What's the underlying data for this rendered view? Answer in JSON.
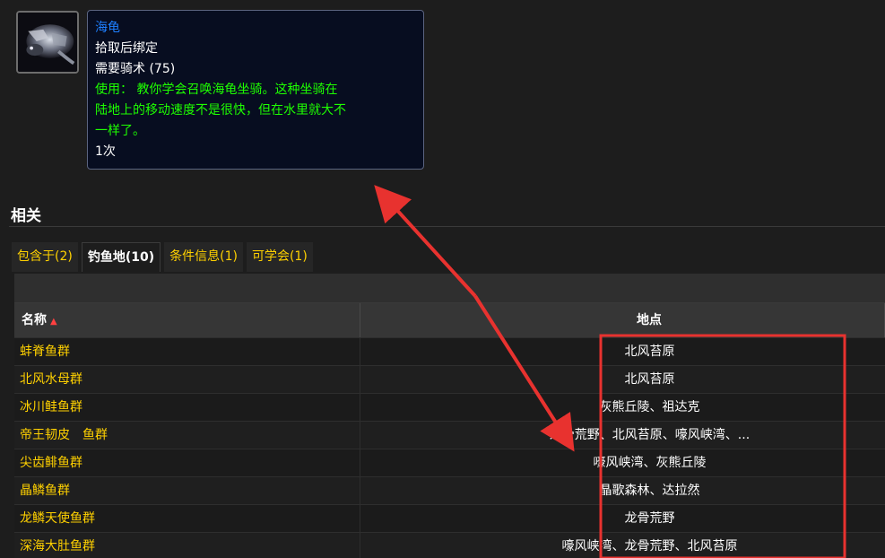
{
  "item": {
    "icon": "sea-turtle-icon",
    "name": "海龟",
    "bind": "拾取后绑定",
    "requires": "需要骑术 (75)",
    "use_lines": [
      "使用： 教你学会召唤海龟坐骑。这种坐骑在",
      "陆地上的移动速度不是很快，但在水里就大不",
      "一样了。"
    ],
    "charges": "1次"
  },
  "related": {
    "title": "相关",
    "tabs": [
      {
        "label": "包含于(2)",
        "active": false
      },
      {
        "label": "钓鱼地(10)",
        "active": true
      },
      {
        "label": "条件信息(1)",
        "active": false
      },
      {
        "label": "可学会(1)",
        "active": false
      }
    ]
  },
  "table": {
    "columns": {
      "name": "名称",
      "location": "地点"
    },
    "rows": [
      {
        "name": "蚌脊鱼群",
        "location": "北风苔原"
      },
      {
        "name": "北风水母群",
        "location": "北风苔原"
      },
      {
        "name": "冰川鲑鱼群",
        "location": "灰熊丘陵、祖达克"
      },
      {
        "name": "帝王韧皮　鱼群",
        "location": "龙骨荒野、北风苔原、嚎风峡湾、..."
      },
      {
        "name": "尖齿鲱鱼群",
        "location": "嚎风峡湾、灰熊丘陵"
      },
      {
        "name": "晶鳞鱼群",
        "location": "晶歌森林、达拉然"
      },
      {
        "name": "龙鳞天使鱼群",
        "location": "龙骨荒野"
      },
      {
        "name": "深海大肚鱼群",
        "location": "嚎风峡湾、龙骨荒野、北风苔原"
      }
    ]
  },
  "colors": {
    "item_name": "#1e7fff",
    "use_text": "#1eff00",
    "link": "#ffd100",
    "annotation": "#e8322f"
  }
}
